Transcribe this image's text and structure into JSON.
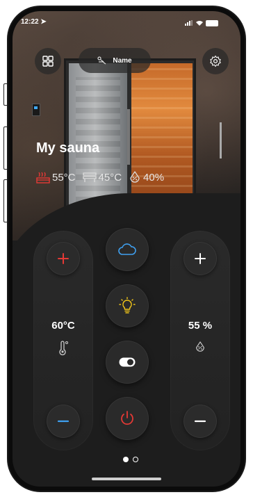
{
  "status_bar": {
    "time": "12:22"
  },
  "header": {
    "name_label": "Name"
  },
  "hero": {
    "title": "My sauna",
    "readouts": [
      {
        "icon": "heater-icon",
        "value": "55°C"
      },
      {
        "icon": "bench-icon",
        "value": "45°C"
      },
      {
        "icon": "humidity-icon",
        "value": "40%"
      }
    ]
  },
  "controls": {
    "temperature": {
      "value": "60°C"
    },
    "humidity": {
      "value": "55 %"
    }
  },
  "pager": {
    "total": 2,
    "active": 1
  },
  "colors": {
    "red": "#e53935",
    "blue": "#3fa0f0",
    "yellow": "#f0c419"
  }
}
